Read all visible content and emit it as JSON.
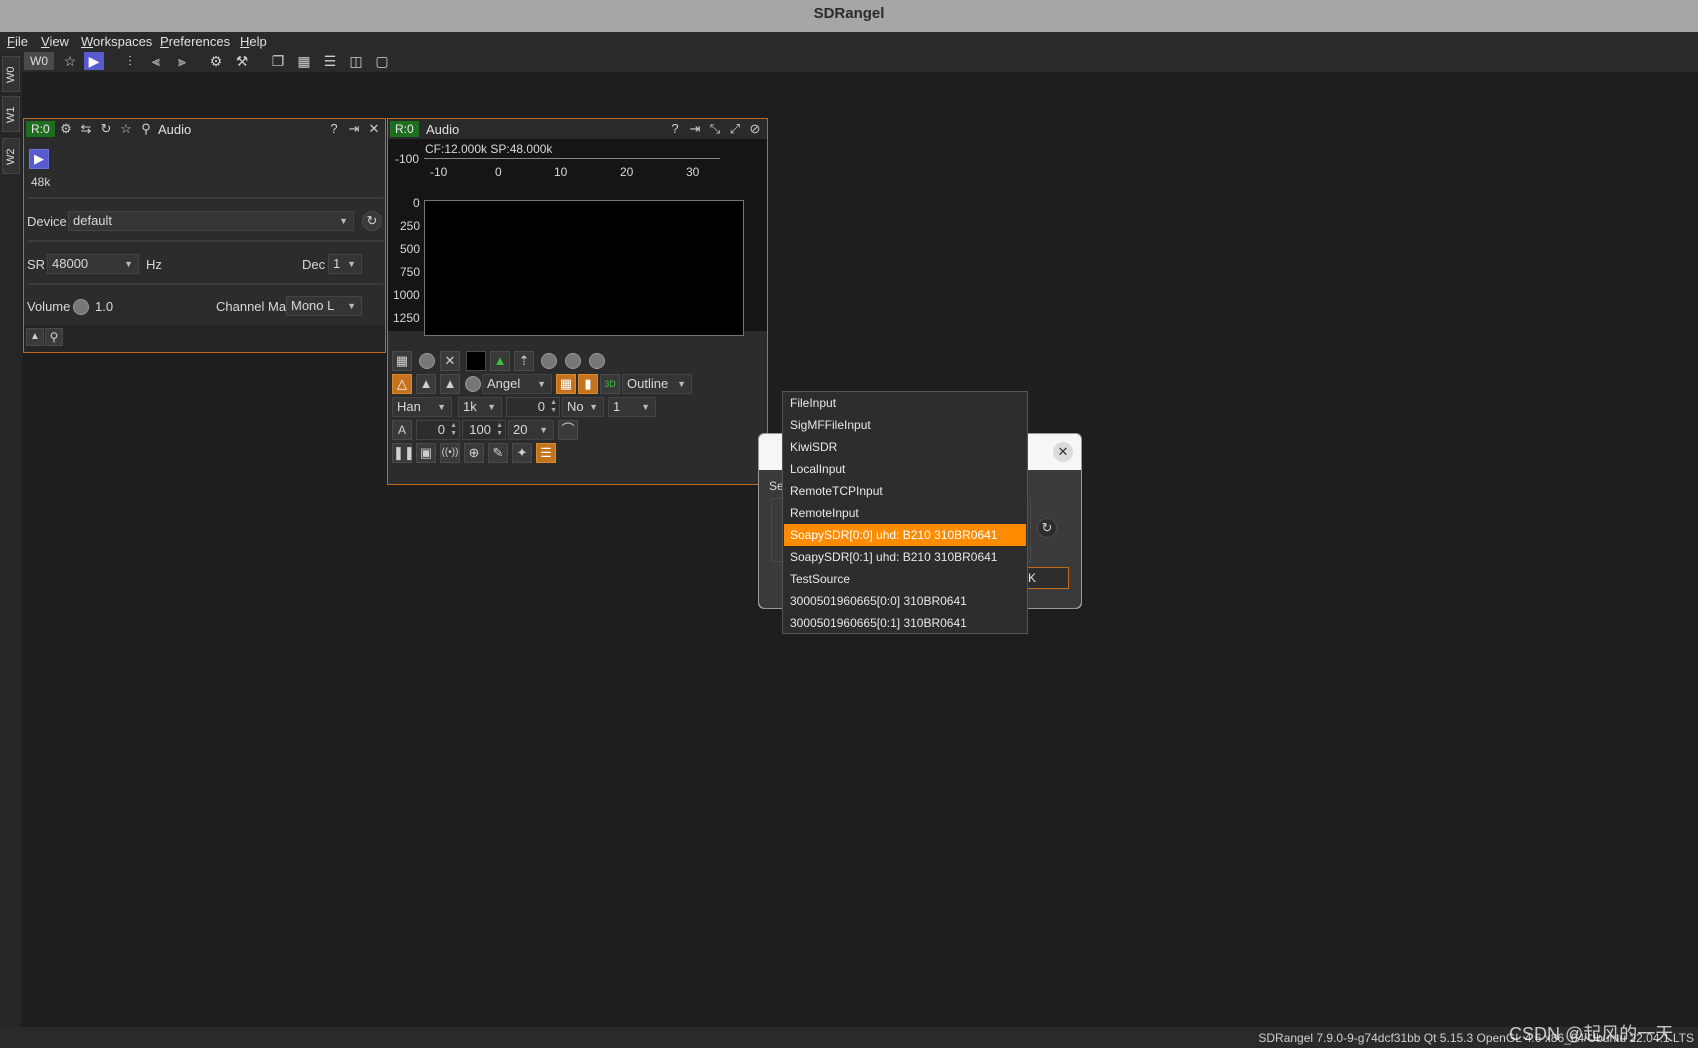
{
  "window": {
    "title": "SDRangel"
  },
  "menu": [
    "File",
    "View",
    "Workspaces",
    "Preferences",
    "Help"
  ],
  "toolbar": {
    "workspace_label": "W0"
  },
  "side_tabs": [
    "W0",
    "W1",
    "W2"
  ],
  "source_panel": {
    "badge": "R:0",
    "title": "Audio",
    "sample_rate_short": "48k",
    "device_label": "Device",
    "device_value": "default",
    "sr_label": "SR",
    "sr_value": "48000",
    "sr_unit": "Hz",
    "dec_label": "Dec",
    "dec_value": "1",
    "volume_label": "Volume",
    "volume_value": "1.0",
    "channel_map_label": "Channel Map",
    "channel_map_value": "Mono L"
  },
  "spectrum_panel": {
    "badge": "R:0",
    "title": "Audio",
    "cf_sp_text": "CF:12.000k SP:48.000k",
    "db_top": "-100",
    "freq_ticks": [
      "-10",
      "0",
      "10",
      "20",
      "30"
    ],
    "waterfall_ticks": [
      "0",
      "250",
      "500",
      "750",
      "1000",
      "1250"
    ],
    "palette": "Angel",
    "style": "Outline",
    "window_fn": "Han",
    "fft_size": "1k",
    "offset_value": "0",
    "averaging_mode": "No",
    "averaging_value": "1",
    "auto_label": "A",
    "ref_level": "0",
    "range": "100",
    "fps": "20"
  },
  "dialog": {
    "partial_label": "Se",
    "ok_label": "OK"
  },
  "dropdown": {
    "items": [
      "FileInput",
      "SigMFFileInput",
      "KiwiSDR",
      "LocalInput",
      "RemoteTCPInput",
      "RemoteInput",
      "SoapySDR[0:0] uhd: B210 310BR0641",
      "SoapySDR[0:1] uhd: B210 310BR0641",
      "TestSource",
      "3000501960665[0:0] 310BR0641",
      "3000501960665[0:1] 310BR0641"
    ],
    "selected": "SoapySDR[0:0] uhd: B210 310BR0641"
  },
  "status": {
    "version": "SDRangel 7.9.0-9-g74dcf31bb Qt 5.15.3 OpenGL 4.6 x86_64 Ubuntu 22.04.1 LTS",
    "watermark": "CSDN @起风的一天"
  },
  "colors": {
    "accent": "#ff8c00",
    "badge": "#1f6d1f",
    "panel_border": "#c26a1a"
  }
}
